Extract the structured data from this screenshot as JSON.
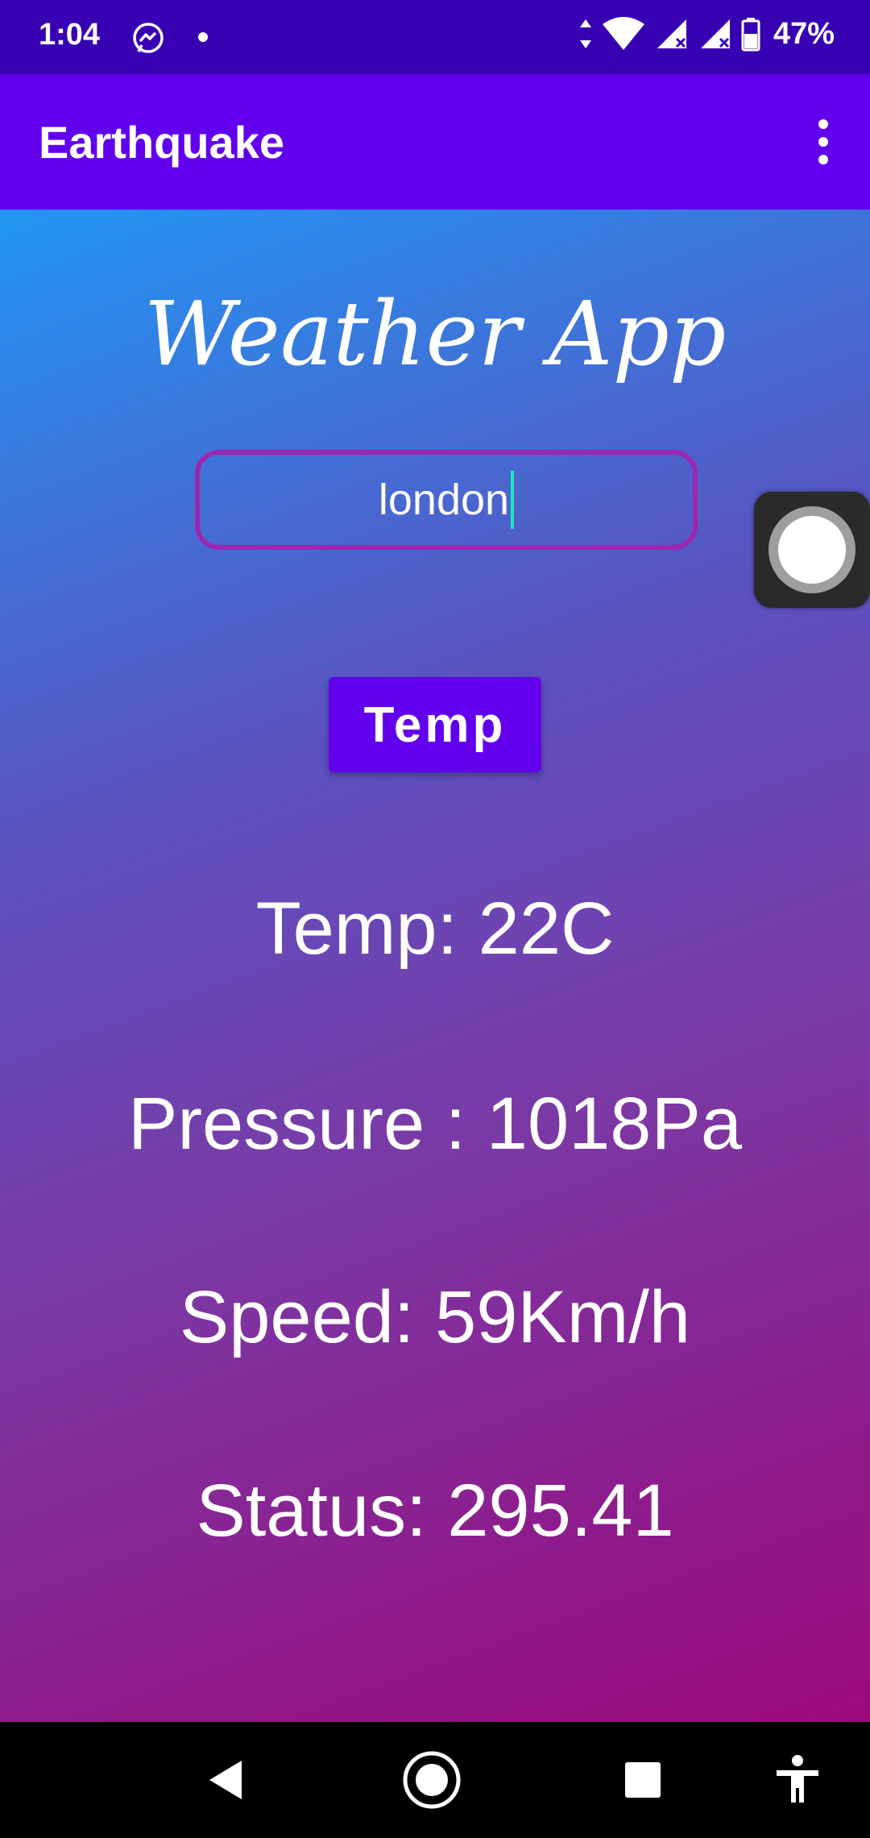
{
  "status_bar": {
    "time": "1:04",
    "battery_percent": "47%",
    "icons": [
      "messenger-icon",
      "notification-dot",
      "data-arrows-icon",
      "wifi-icon",
      "signal-icon",
      "signal-icon-2",
      "battery-icon"
    ]
  },
  "app_bar": {
    "title": "Earthquake",
    "menu_icon": "more-vertical-icon"
  },
  "main": {
    "heading": "Weather App",
    "city_input": {
      "value": "london"
    },
    "temp_button_label": "Temp",
    "readouts": {
      "temp": "Temp: 22C",
      "pressure": "Pressure : 1018Pa",
      "speed": "Speed: 59Km/h",
      "status": "Status: 295.41"
    }
  },
  "overlay": {
    "assistive_touch": "assistive-touch-icon"
  },
  "nav_bar": {
    "buttons": [
      "back-icon",
      "home-icon",
      "recents-icon",
      "accessibility-icon"
    ]
  },
  "colors": {
    "status_bar": "#3700b3",
    "app_bar": "#6200ee",
    "button": "#6200ee",
    "input_border": "#9c27b0",
    "caret": "#1de9b6",
    "gradient_top": "#2196f3",
    "gradient_bottom": "#9c0a7a"
  }
}
